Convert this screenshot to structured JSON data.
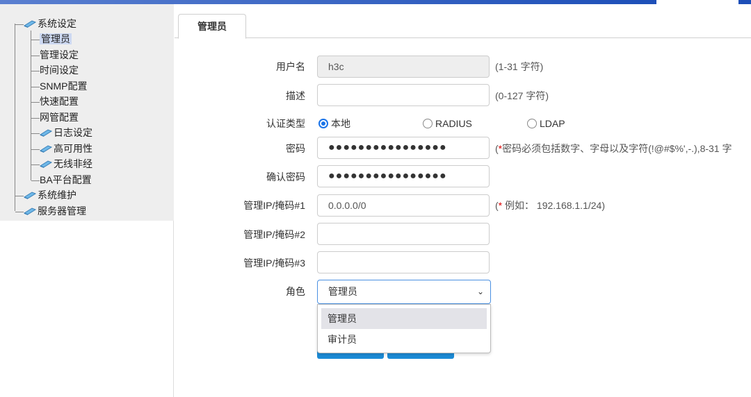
{
  "sidebar": {
    "items": [
      {
        "label": "系统设定",
        "icon": "book-icon"
      },
      {
        "label": "管理员"
      },
      {
        "label": "管理设定"
      },
      {
        "label": "时间设定"
      },
      {
        "label": "SNMP配置"
      },
      {
        "label": "快速配置"
      },
      {
        "label": "网管配置"
      },
      {
        "label": "日志设定",
        "icon": "book-icon"
      },
      {
        "label": "高可用性",
        "icon": "book-icon"
      },
      {
        "label": "无线非经",
        "icon": "book-icon"
      },
      {
        "label": "BA平台配置"
      },
      {
        "label": "系统维护",
        "icon": "book-icon"
      },
      {
        "label": "服务器管理",
        "icon": "book-icon"
      }
    ],
    "selected": "管理员"
  },
  "tab": {
    "label": "管理员"
  },
  "form": {
    "username": {
      "label": "用户名",
      "value": "h3c",
      "hint": "(1-31 字符)"
    },
    "description": {
      "label": "描述",
      "value": "",
      "hint": "(0-127 字符)"
    },
    "auth": {
      "label": "认证类型",
      "options": [
        "本地",
        "RADIUS",
        "LDAP"
      ],
      "selected": "本地"
    },
    "password": {
      "label": "密码",
      "value": "●●●●●●●●●●●●●●●●",
      "hint_star": "*",
      "hint": "密码必须包括数字、字母以及字符(!@#$%',-.),8-31 字",
      "hint_open": "("
    },
    "confirm": {
      "label": "确认密码",
      "value": "●●●●●●●●●●●●●●●●"
    },
    "ip1": {
      "label": "管理IP/掩码#1",
      "value": "0.0.0.0/0",
      "hint_open": "(",
      "hint_star": "*",
      "hint": " 例如：  192.168.1.1/24)"
    },
    "ip2": {
      "label": "管理IP/掩码#2",
      "value": ""
    },
    "ip3": {
      "label": "管理IP/掩码#3",
      "value": ""
    },
    "role": {
      "label": "角色",
      "value": "管理员",
      "options": [
        "管理员",
        "审计员"
      ]
    }
  },
  "colors": {
    "accent": "#1a73e8",
    "topbar": "#1d4fb8",
    "button": "#1c8bd6"
  }
}
